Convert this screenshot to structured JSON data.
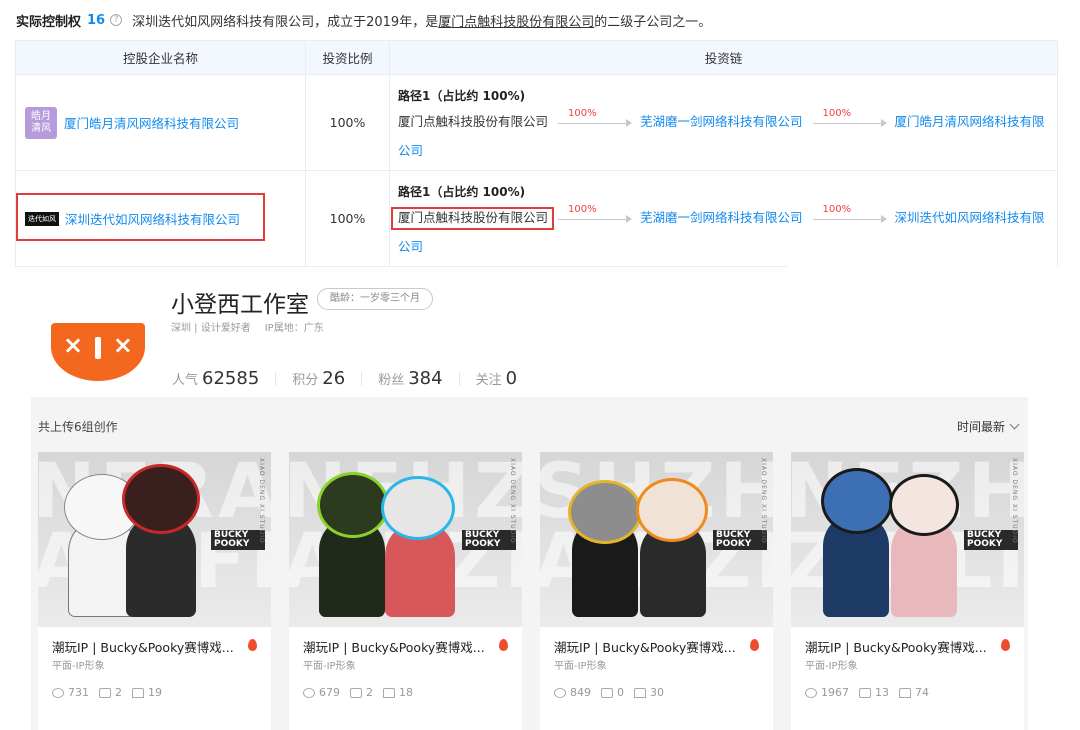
{
  "control": {
    "title": "实际控制权",
    "count": "16",
    "help_icon": "question-circle-icon",
    "desc_prefix": "深圳迭代如风网络科技有限公司，成立于2019年，是",
    "desc_link": "厦门点触科技股份有限公司",
    "desc_suffix": "的二级子公司之一。",
    "table": {
      "headers": [
        "控股企业名称",
        "投资比例",
        "投资链"
      ],
      "rows": [
        {
          "logo_text": "皓月清风",
          "company": "厦门皓月清风网络科技有限公司",
          "ratio": "100%",
          "path_title": "路径1（占比约 100%)",
          "chain_start": "厦门点触科技股份有限公司",
          "pct1": "100%",
          "mid": "芜湖磨一剑网络科技有限公司",
          "pct2": "100%",
          "end": "厦门皓月清风网络科技有限",
          "end_cont": "公司"
        },
        {
          "logo_text": "迭代如风",
          "company": "深圳迭代如风网络科技有限公司",
          "ratio": "100%",
          "path_title": "路径1（占比约 100%)",
          "chain_start": "厦门点触科技股份有限公司",
          "pct1": "100%",
          "mid": "芜湖磨一剑网络科技有限公司",
          "pct2": "100%",
          "end": "深圳迭代如风网络科技有限",
          "end_cont": "公司"
        }
      ]
    },
    "highlight_color": "#e03c3c",
    "link_color": "#128bed"
  },
  "studio": {
    "name": "小登西工作室",
    "age": "酷龄：一岁零三个月",
    "location": "深圳 | 设计爱好者",
    "ip_location": "IP属地：广东",
    "logo_color": "#f4671f",
    "stats": [
      {
        "label": "人气",
        "value": "62585"
      },
      {
        "label": "积分",
        "value": "26"
      },
      {
        "label": "粉丝",
        "value": "384"
      },
      {
        "label": "关注",
        "value": "0"
      }
    ]
  },
  "works": {
    "count_text": "共上传6组创作",
    "sort_label": "时间最新",
    "items": [
      {
        "title": "潮玩IP | Bucky&Pooky赛博戏...",
        "category": "平面-IP形象",
        "views": "731",
        "comments": "2",
        "likes": "19"
      },
      {
        "title": "潮玩IP | Bucky&Pooky赛博戏...",
        "category": "平面-IP形象",
        "views": "679",
        "comments": "2",
        "likes": "18"
      },
      {
        "title": "潮玩IP | Bucky&Pooky赛博戏...",
        "category": "平面-IP形象",
        "views": "849",
        "comments": "0",
        "likes": "30"
      },
      {
        "title": "潮玩IP | Bucky&Pooky赛博戏...",
        "category": "平面-IP形象",
        "views": "1967",
        "comments": "13",
        "likes": "74"
      }
    ],
    "brand_text": "BUCKY POOKY",
    "vertical_text": "XIAO DENG XI STUDIO"
  }
}
